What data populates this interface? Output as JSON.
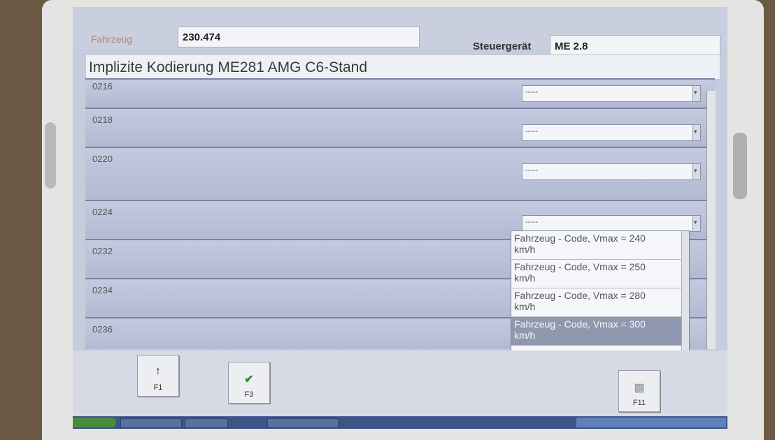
{
  "header": {
    "vehicle_label": "Fahrzeug",
    "vehicle_value": "230.474",
    "controller_label": "Steuergerät",
    "controller_value": "ME 2.8"
  },
  "coding_title": "Implizite Kodierung ME281 AMG C6-Stand",
  "rows": [
    {
      "code": "0216",
      "value": "-----"
    },
    {
      "code": "0218",
      "value": "-----"
    },
    {
      "code": "0220",
      "value": "-----"
    },
    {
      "code": "0224",
      "value": "-----"
    },
    {
      "code": "0232"
    },
    {
      "code": "0234"
    },
    {
      "code": "0236"
    }
  ],
  "dropdown": {
    "options": [
      "Fahrzeug - Code, Vmax = 240 km/h",
      "Fahrzeug - Code, Vmax = 250 km/h",
      "Fahrzeug - Code, Vmax = 280 km/h",
      "Fahrzeug - Code, Vmax = 300 km/h",
      "-----"
    ],
    "selected_index": 3
  },
  "toolbar": {
    "f1_label": "F1",
    "f3_label": "F3",
    "f11_label": "F11"
  },
  "colors": {
    "window_bg": "#c6ccdc",
    "selected_option_bg": "#8f98ae",
    "taskbar_bg": "#3c5486"
  },
  "icons": {
    "f1": "arrow-up-icon",
    "f3": "checkmark-icon",
    "f11": "printer-icon"
  }
}
